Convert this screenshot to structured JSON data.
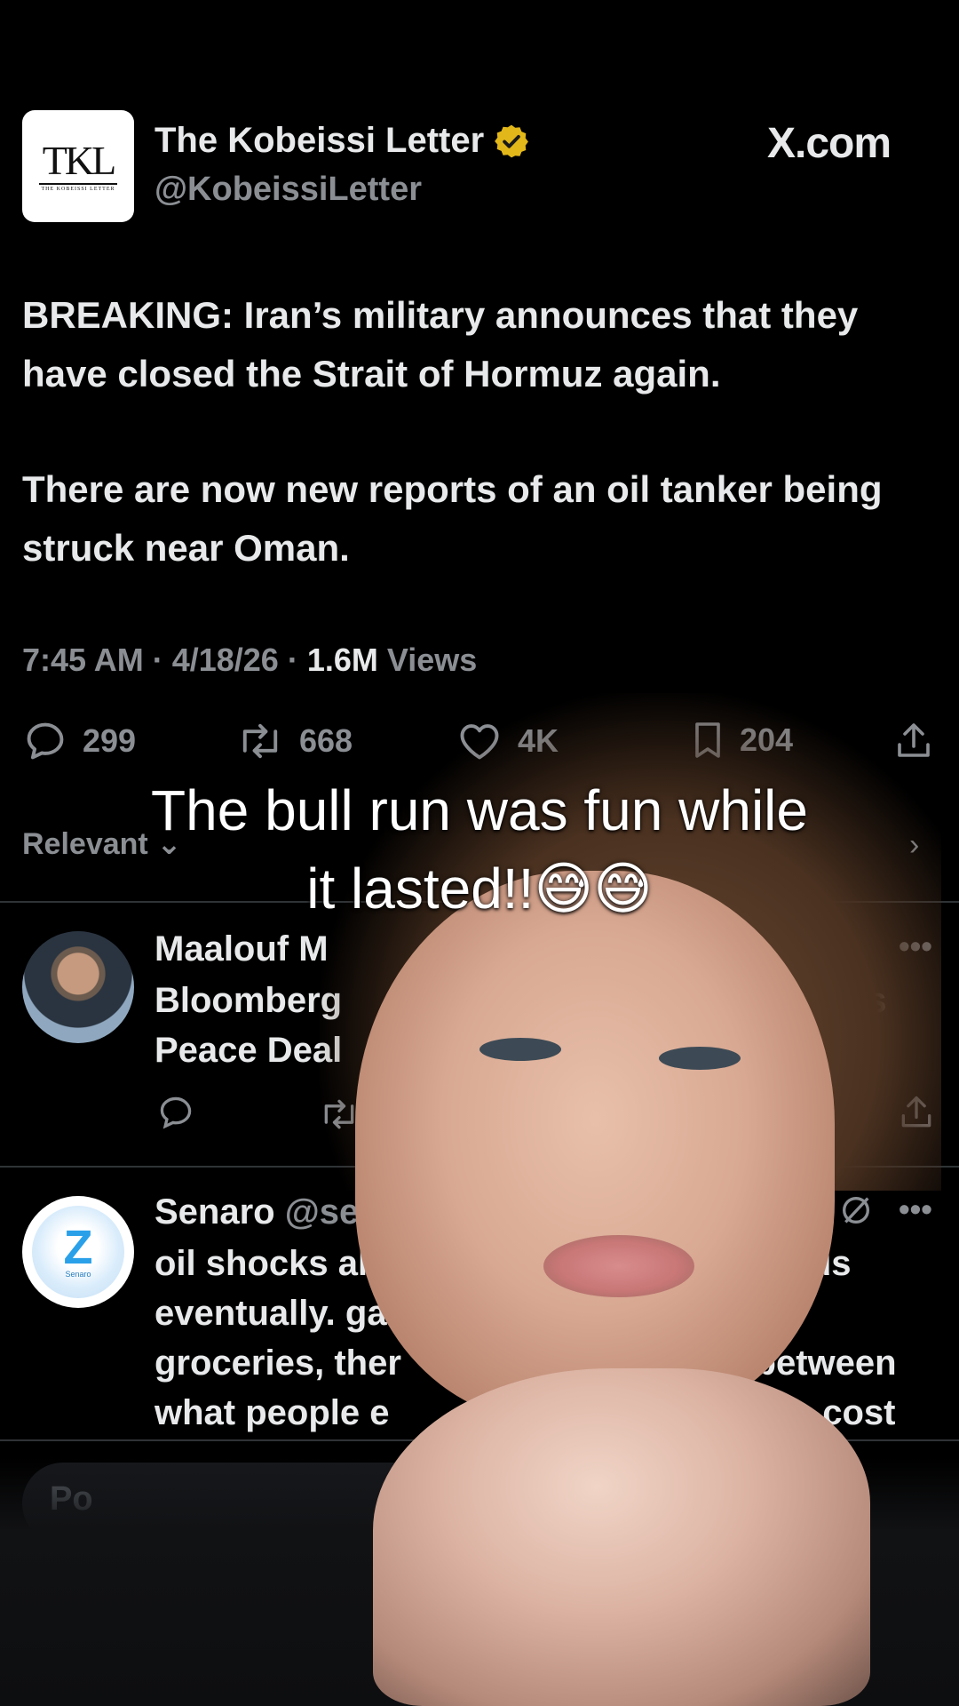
{
  "header": {
    "logo_text": "TKL",
    "logo_subtext": "THE KOBEISSI LETTER",
    "name": "The Kobeissi Letter",
    "handle": "@KobeissiLetter",
    "site": "X.com"
  },
  "tweet": {
    "paragraphs": [
      "BREAKING: Iran’s military announces that they have closed the Strait of Hormuz again.",
      "There are now new reports of an oil tanker being struck near Oman."
    ],
    "time": "7:45 AM",
    "date": "4/18/26",
    "views_count": "1.6M",
    "views_label": "Views",
    "replies": "299",
    "reposts": "668",
    "likes": "4K",
    "bookmarks": "204"
  },
  "sort_label": "Relevant",
  "replies": [
    {
      "name_partial": "Maalouf M",
      "lines": [
        "Bloomberg",
        "Peace Deal"
      ],
      "trail_text": "as"
    },
    {
      "name": "Senaro",
      "handle_partial": "@sena",
      "lines": [
        "oil shocks alwa",
        "eventually. gas",
        "groceries, ther",
        "what people e"
      ],
      "trail_lines": [
        "ards",
        "n",
        "p between",
        "ngs cost"
      ],
      "avatar_label": "Senaro"
    }
  ],
  "post_placeholder": "Po",
  "caption_line1": "The bull run was fun while",
  "caption_line2": "it lasted!!😅😅"
}
